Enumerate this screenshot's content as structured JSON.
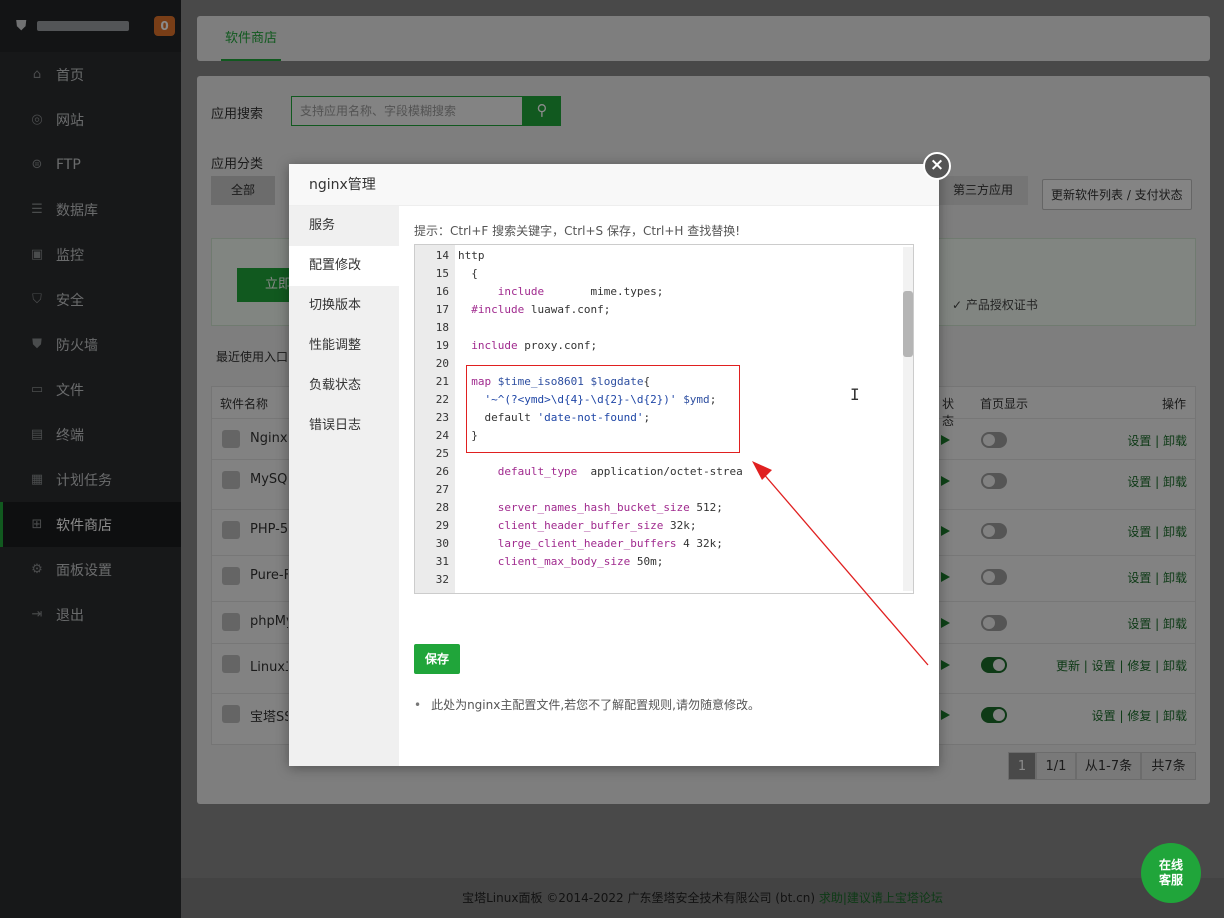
{
  "sidebar": {
    "badge": "0",
    "items": [
      {
        "label": "首页",
        "icon": "home-icon"
      },
      {
        "label": "网站",
        "icon": "globe-icon"
      },
      {
        "label": "FTP",
        "icon": "ftp-icon"
      },
      {
        "label": "数据库",
        "icon": "database-icon"
      },
      {
        "label": "监控",
        "icon": "monitor-icon"
      },
      {
        "label": "安全",
        "icon": "shield-icon"
      },
      {
        "label": "防火墙",
        "icon": "firewall-icon"
      },
      {
        "label": "文件",
        "icon": "folder-icon"
      },
      {
        "label": "终端",
        "icon": "terminal-icon"
      },
      {
        "label": "计划任务",
        "icon": "calendar-icon"
      },
      {
        "label": "软件商店",
        "icon": "grid-icon"
      },
      {
        "label": "面板设置",
        "icon": "gear-icon"
      },
      {
        "label": "退出",
        "icon": "logout-icon"
      }
    ]
  },
  "page": {
    "tab": "软件商店",
    "search_label": "应用搜索",
    "search_placeholder": "支持应用名称、字段模糊搜索",
    "category_label": "应用分类",
    "category_all": "全部",
    "category_third": "第三方应用",
    "refresh_button": "更新软件列表 / 支付状态",
    "buy_button": "立即",
    "license": "✓ 产品授权证书",
    "recent": "最近使用入口",
    "table_headers": {
      "name": "软件名称",
      "status": "状态",
      "home": "首页显示",
      "ops": "操作"
    },
    "rows": [
      {
        "name": "Nginx",
        "ops": "设置 | 卸载",
        "on": false
      },
      {
        "name": "MySQL",
        "ops": "设置 | 卸载",
        "on": false
      },
      {
        "name": "PHP-5.",
        "ops": "设置 | 卸载",
        "on": false
      },
      {
        "name": "Pure-F",
        "ops": "设置 | 卸载",
        "on": false
      },
      {
        "name": "phpMy",
        "ops": "设置 | 卸载",
        "on": false
      },
      {
        "name": "Linux工",
        "ops": "更新 | 设置 | 修复 | 卸载",
        "on": true
      },
      {
        "name": "宝塔SS",
        "ops": "设置 | 修复 | 卸载",
        "on": true
      }
    ],
    "pager": {
      "current": "1",
      "total_pages": "1/1",
      "range": "从1-7条",
      "count": "共7条"
    }
  },
  "footer": {
    "copyright": "宝塔Linux面板 ©2014-2022 广东堡塔安全技术有限公司 (bt.cn)",
    "link": "求助|建议请上宝塔论坛"
  },
  "chat": {
    "line1": "在线",
    "line2": "客服"
  },
  "modal": {
    "title": "nginx管理",
    "close": "×",
    "nav": [
      "服务",
      "配置修改",
      "切换版本",
      "性能调整",
      "负载状态",
      "错误日志"
    ],
    "tip": "提示：Ctrl+F 搜索关键字，Ctrl+S 保存，Ctrl+H 查找替换!",
    "save": "保存",
    "note": "此处为nginx主配置文件,若您不了解配置规则,请勿随意修改。",
    "lines": [
      {
        "n": "14",
        "t": "http"
      },
      {
        "n": "15",
        "t": "  {"
      },
      {
        "n": "16",
        "t": "      include       mime.types;"
      },
      {
        "n": "17",
        "t": "  #include luawaf.conf;"
      },
      {
        "n": "18",
        "t": ""
      },
      {
        "n": "19",
        "t": "  include proxy.conf;"
      },
      {
        "n": "20",
        "t": ""
      },
      {
        "n": "21",
        "t": "  map $time_iso8601 $logdate{"
      },
      {
        "n": "22",
        "t": "    '~^(?<ymd>\\d{4}-\\d{2}-\\d{2})' $ymd;"
      },
      {
        "n": "23",
        "t": "    default 'date-not-found';"
      },
      {
        "n": "24",
        "t": "  }"
      },
      {
        "n": "25",
        "t": ""
      },
      {
        "n": "26",
        "t": "      default_type  application/octet-strea"
      },
      {
        "n": "27",
        "t": ""
      },
      {
        "n": "28",
        "t": "      server_names_hash_bucket_size 512;"
      },
      {
        "n": "29",
        "t": "      client_header_buffer_size 32k;"
      },
      {
        "n": "30",
        "t": "      large_client_header_buffers 4 32k;"
      },
      {
        "n": "31",
        "t": "      client_max_body_size 50m;"
      },
      {
        "n": "32",
        "t": ""
      }
    ]
  },
  "colors": {
    "accent": "#20a53a",
    "annotation": "#e02020"
  }
}
